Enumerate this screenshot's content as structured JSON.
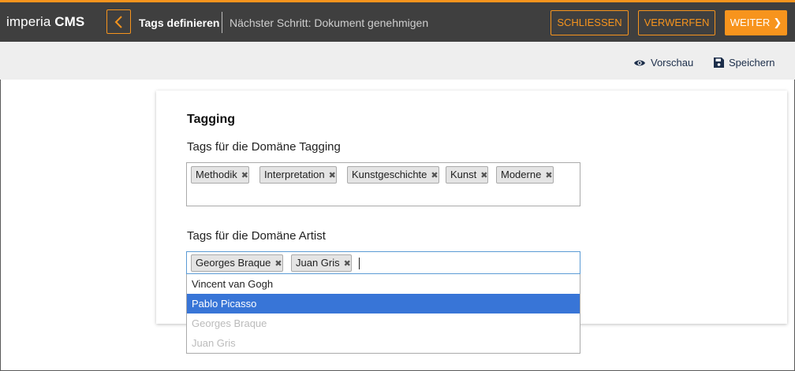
{
  "header": {
    "logo_light": "imperia",
    "logo_bold": "CMS",
    "title": "Tags definieren",
    "next_step": "Nächster Schritt: Dokument genehmigen",
    "close_label": "SCHLIESSEN",
    "discard_label": "VERWERFEN",
    "next_label": "WEITER",
    "accent_color": "#f7941d"
  },
  "toolbar": {
    "preview_label": "Vorschau",
    "save_label": "Speichern"
  },
  "form": {
    "section_title": "Tagging",
    "field1": {
      "label": "Tags für die Domäne Tagging",
      "tags": [
        "Methodik",
        "Interpretation",
        "Kunstgeschichte",
        "Kunst",
        "Moderne"
      ]
    },
    "field2": {
      "label": "Tags für die Domäne Artist",
      "tags": [
        "Georges Braque",
        "Juan Gris"
      ],
      "options": [
        "Vincent van Gogh",
        "Pablo Picasso",
        "Georges Braque",
        "Juan Gris"
      ]
    }
  }
}
